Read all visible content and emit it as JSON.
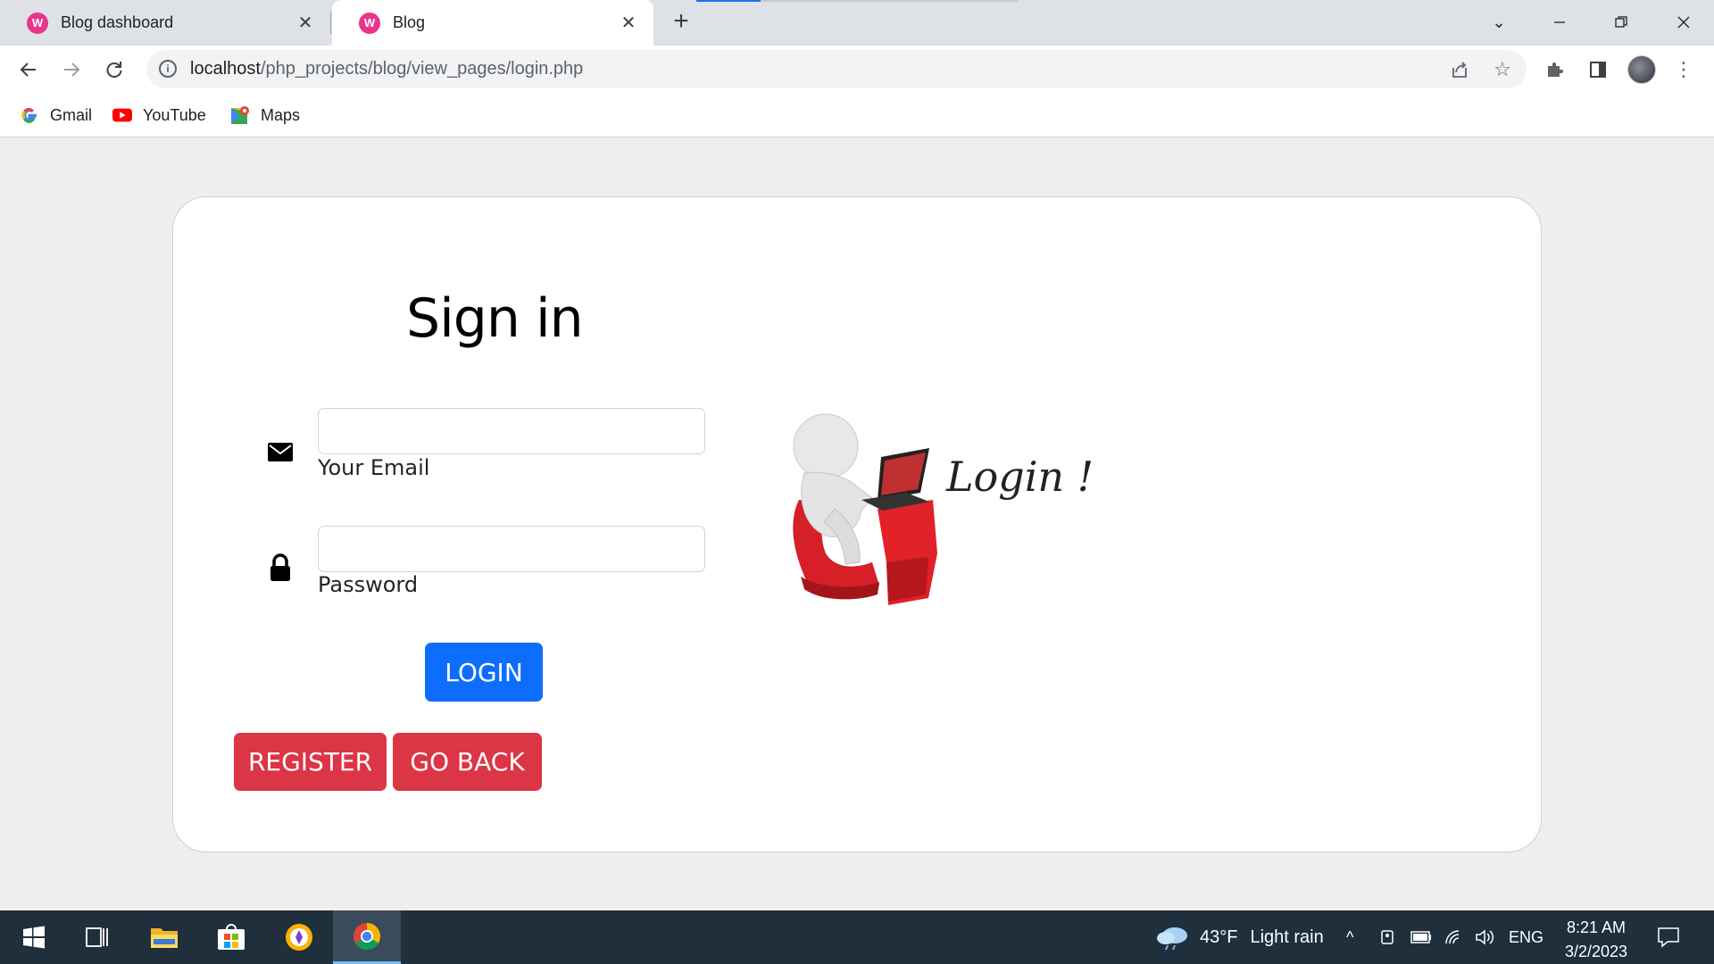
{
  "browser": {
    "tabs": [
      {
        "title": "Blog dashboard",
        "favicon": "wamp-icon",
        "active": false
      },
      {
        "title": "Blog",
        "favicon": "wamp-icon",
        "active": true
      }
    ],
    "new_tab_symbol": "+",
    "url_host": "localhost",
    "url_path": "/php_projects/blog/view_pages/login.php",
    "bookmarks": [
      {
        "label": "Gmail",
        "icon": "google-icon"
      },
      {
        "label": "YouTube",
        "icon": "youtube-icon"
      },
      {
        "label": "Maps",
        "icon": "maps-icon"
      }
    ]
  },
  "login": {
    "title": "Sign in",
    "email_label": "Your Email",
    "email_value": "",
    "password_label": "Password",
    "password_value": "",
    "login_button": "LOGIN",
    "register_button": "REGISTER",
    "go_back_button": "GO BACK",
    "illustration_text": "Login !"
  },
  "taskbar": {
    "weather_temp": "43°F",
    "weather_desc": "Light rain",
    "language": "ENG",
    "time": "8:21 AM",
    "date": "3/2/2023"
  },
  "colors": {
    "primary": "#0d6efd",
    "danger": "#dc3545",
    "taskbar": "#1f2f3c"
  }
}
